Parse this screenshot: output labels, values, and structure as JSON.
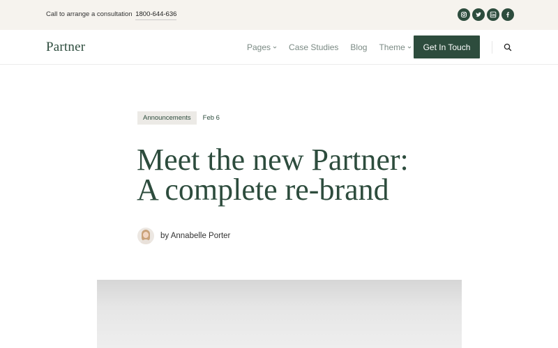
{
  "topbar": {
    "call_text": "Call to arrange a consultation",
    "phone": "1800-644-636",
    "socials": [
      "instagram-icon",
      "twitter-icon",
      "linkedin-icon",
      "facebook-icon"
    ]
  },
  "nav": {
    "logo": "Partner",
    "items": [
      {
        "label": "Pages",
        "has_dropdown": true
      },
      {
        "label": "Case Studies",
        "has_dropdown": false
      },
      {
        "label": "Blog",
        "has_dropdown": false
      },
      {
        "label": "Theme",
        "has_dropdown": true
      }
    ],
    "cta": "Get In Touch",
    "search_icon": "search-icon"
  },
  "post": {
    "category": "Announcements",
    "date": "Feb 6",
    "title_line1": "Meet the new Partner:",
    "title_line2": "A complete re-brand",
    "byline": "by Annabelle Porter"
  },
  "colors": {
    "brand": "#2d4c3d",
    "topbar_bg": "#f6f3ee",
    "tag_bg": "#eceae6",
    "nav_text": "#7b8a84"
  }
}
